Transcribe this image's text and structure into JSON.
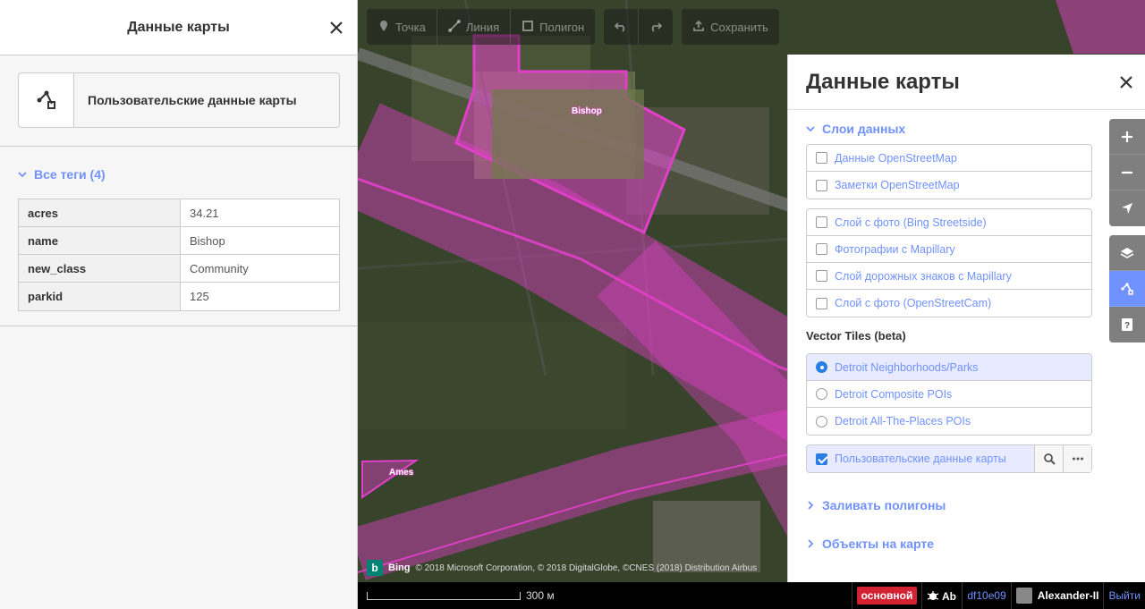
{
  "sidebar": {
    "title": "Данные карты",
    "custom_data_label": "Пользовательские данные карты",
    "all_tags_label": "Все теги (4)",
    "tags": [
      {
        "key": "acres",
        "value": "34.21"
      },
      {
        "key": "name",
        "value": "Bishop"
      },
      {
        "key": "new_class",
        "value": "Community"
      },
      {
        "key": "parkid",
        "value": "125"
      }
    ]
  },
  "toolbar": {
    "point": "Точка",
    "line": "Линия",
    "polygon": "Полигон",
    "save": "Сохранить"
  },
  "map": {
    "labels": [
      "Bishop",
      "Ames"
    ],
    "colors": {
      "overlay": "#e040c8",
      "accent": "#7092ff"
    }
  },
  "panel": {
    "title": "Данные карты",
    "data_layers_label": "Слои данных",
    "osm_layers": [
      "Данные OpenStreetMap",
      "Заметки OpenStreetMap"
    ],
    "photo_layers": [
      "Слой с фото (Bing Streetside)",
      "Фотографии с Mapillary",
      "Слой дорожных знаков с Mapillary",
      "Слой с фото (OpenStreetCam)"
    ],
    "vector_tiles_label": "Vector Tiles (beta)",
    "vector_tiles": [
      "Detroit Neighborhoods/Parks",
      "Detroit Composite POIs",
      "Detroit All-The-Places POIs"
    ],
    "vector_selected": "Detroit Neighborhoods/Parks",
    "custom_layer": "Пользовательские данные карты",
    "fill_polygons": "Заливать полигоны",
    "map_features": "Объекты на карте"
  },
  "attribution": {
    "bing": "Bing",
    "text": "© 2018 Microsoft Corporation, © 2018 DigitalGlobe, ©CNES (2018) Distribution Airbus"
  },
  "footer": {
    "scale": "300 м",
    "badge": "основной",
    "version": "df10e09",
    "user": "Alexander-II",
    "logout": "Выйти"
  }
}
